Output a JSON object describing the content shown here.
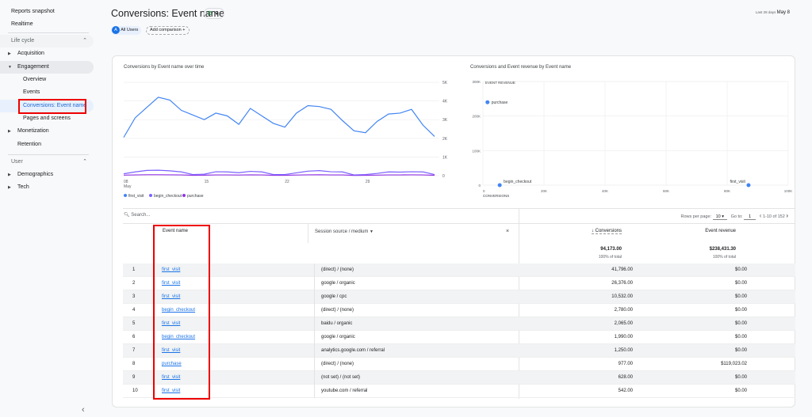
{
  "sidebar": {
    "reports_snapshot": "Reports snapshot",
    "realtime": "Realtime",
    "lifecycle": "Life cycle",
    "acquisition": "Acquisition",
    "engagement": "Engagement",
    "overview": "Overview",
    "events": "Events",
    "conversions": "Conversions: Event name",
    "pages": "Pages and screens",
    "monetization": "Monetization",
    "retention": "Retention",
    "user": "User",
    "demographics": "Demographics",
    "tech": "Tech",
    "collapse": "‹"
  },
  "header": {
    "title": "Conversions: Event name",
    "date_label": "Last 28 days",
    "date_value": "May 8",
    "segment_letter": "A",
    "segment": "All Users",
    "add_comparison": "Add comparison"
  },
  "chart_data": [
    {
      "type": "line",
      "title": "Conversions by Event name over time",
      "x_ticks": [
        "08",
        "15",
        "22",
        "29"
      ],
      "x_sub": "May",
      "y_ticks": [
        "5K",
        "4K",
        "3K",
        "2K",
        "1K",
        "0"
      ],
      "ylim": [
        0,
        5000
      ],
      "series": [
        {
          "name": "first_visit",
          "color": "#4285f4",
          "values": [
            2050,
            3100,
            3650,
            4200,
            4050,
            3500,
            3250,
            3000,
            3350,
            3200,
            2750,
            3600,
            3200,
            2800,
            2600,
            3350,
            3750,
            3700,
            3550,
            2950,
            2400,
            2300,
            2900,
            3300,
            3350,
            3550,
            2700,
            2100
          ]
        },
        {
          "name": "begin_checkout",
          "color": "#7b61ff",
          "values": [
            100,
            200,
            280,
            290,
            260,
            200,
            60,
            80,
            210,
            200,
            160,
            230,
            200,
            60,
            60,
            150,
            240,
            270,
            210,
            200,
            40,
            60,
            120,
            200,
            190,
            210,
            200,
            60
          ]
        },
        {
          "name": "purchase",
          "color": "#9334e6",
          "values": [
            30,
            40,
            50,
            50,
            45,
            40,
            20,
            25,
            40,
            40,
            35,
            45,
            40,
            20,
            20,
            35,
            45,
            50,
            40,
            40,
            15,
            20,
            30,
            40,
            40,
            45,
            40,
            20
          ]
        }
      ]
    },
    {
      "type": "scatter",
      "title": "Conversions and Event revenue by Event name",
      "xlabel": "CONVERSIONS",
      "ylabel": "EVENT REVENUE",
      "x_ticks": [
        "0",
        "20K",
        "40K",
        "60K",
        "80K",
        "100K"
      ],
      "y_ticks": [
        "300K",
        "200K",
        "100K",
        "0"
      ],
      "xlim": [
        0,
        100000
      ],
      "ylim": [
        0,
        300000
      ],
      "points": [
        {
          "label": "purchase",
          "x": 1500,
          "y": 240000
        },
        {
          "label": "begin_checkout",
          "x": 5500,
          "y": 0
        },
        {
          "label": "first_visit",
          "x": 87000,
          "y": 0
        }
      ]
    }
  ],
  "table": {
    "search_placeholder": "Search...",
    "rows_per_page_label": "Rows per page:",
    "rows_per_page": "10",
    "goto_label": "Go to:",
    "goto": "1",
    "range": "1-10 of 152",
    "col_event": "Event name",
    "col_source": "Session source / medium",
    "col_conv": "Conversions",
    "col_rev": "Event revenue",
    "total_conv": "94,173.00",
    "total_rev": "$238,431.30",
    "pct": "100% of total",
    "rows": [
      {
        "n": "1",
        "event": "first_visit",
        "source": "(direct) / (none)",
        "conv": "41,796.00",
        "rev": "$0.00"
      },
      {
        "n": "2",
        "event": "first_visit",
        "source": "google / organic",
        "conv": "26,376.00",
        "rev": "$0.00"
      },
      {
        "n": "3",
        "event": "first_visit",
        "source": "google / cpc",
        "conv": "10,532.00",
        "rev": "$0.00"
      },
      {
        "n": "4",
        "event": "begin_checkout",
        "source": "(direct) / (none)",
        "conv": "2,780.00",
        "rev": "$0.00"
      },
      {
        "n": "5",
        "event": "first_visit",
        "source": "baidu / organic",
        "conv": "2,065.00",
        "rev": "$0.00"
      },
      {
        "n": "6",
        "event": "begin_checkout",
        "source": "google / organic",
        "conv": "1,990.00",
        "rev": "$0.00"
      },
      {
        "n": "7",
        "event": "first_visit",
        "source": "analytics.google.com / referral",
        "conv": "1,250.00",
        "rev": "$0.00"
      },
      {
        "n": "8",
        "event": "purchase",
        "source": "(direct) / (none)",
        "conv": "977.00",
        "rev": "$119,023.02"
      },
      {
        "n": "9",
        "event": "first_visit",
        "source": "(not set) / (not set)",
        "conv": "628.00",
        "rev": "$0.00"
      },
      {
        "n": "10",
        "event": "first_visit",
        "source": "youtube.com / referral",
        "conv": "542.00",
        "rev": "$0.00"
      }
    ]
  }
}
